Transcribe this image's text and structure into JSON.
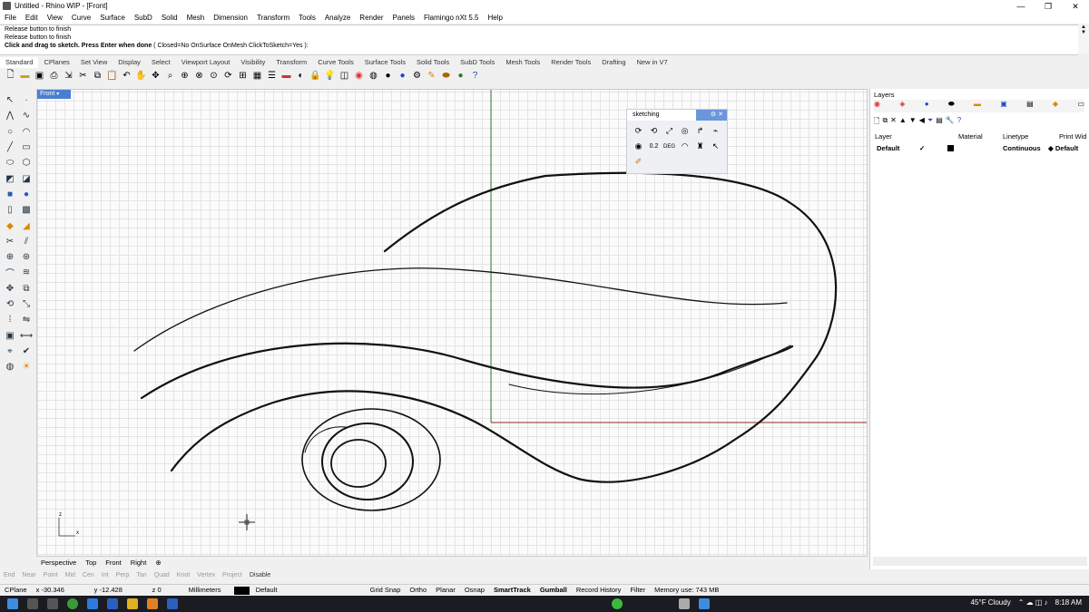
{
  "window": {
    "title": "Untitled - Rhino WIP - [Front]",
    "minimize": "—",
    "restore": "❐",
    "close": "✕"
  },
  "menu": [
    "File",
    "Edit",
    "View",
    "Curve",
    "Surface",
    "SubD",
    "Solid",
    "Mesh",
    "Dimension",
    "Transform",
    "Tools",
    "Analyze",
    "Render",
    "Panels",
    "Flamingo nXt 5.5",
    "Help"
  ],
  "command": {
    "history": [
      "Release button to finish",
      "Release button to finish"
    ],
    "prompt": "Click and drag to sketch. Press Enter when done",
    "options": "( Closed=No OnSurface OnMesh ClickToSketch=Yes ):"
  },
  "tabs": [
    "Standard",
    "CPlanes",
    "Set View",
    "Display",
    "Select",
    "Viewport Layout",
    "Visibility",
    "Transform",
    "Curve Tools",
    "Surface Tools",
    "Solid Tools",
    "SubD Tools",
    "Mesh Tools",
    "Render Tools",
    "Drafting",
    "New in V7"
  ],
  "toolbar_icons": [
    "new-icon",
    "open-icon",
    "save-icon",
    "print-icon",
    "import-icon",
    "cut-icon",
    "copy-icon",
    "paste-icon",
    "undo-icon",
    "pan-icon",
    "move-icon",
    "zoom-icon",
    "zoom-window-icon",
    "zoom-extents-icon",
    "zoom-selected-icon",
    "rotate-view-icon",
    "viewport-4-icon",
    "grid-icon",
    "properties-icon",
    "car-icon",
    "hide-icon",
    "lock-icon",
    "light-icon",
    "layer-icon",
    "color-icon",
    "material-icon",
    "render-icon",
    "render-preview-icon",
    "settings-icon",
    "pencil-icon",
    "car2-icon",
    "render-sphere-icon",
    "help-icon"
  ],
  "viewport": {
    "label": "Front",
    "x_label": "x",
    "z_label": "z"
  },
  "sketching_panel": {
    "title": "sketching",
    "gear": "⚙",
    "close": "✕",
    "value_label": "0.2",
    "deg_label": "DEG"
  },
  "viewport_tabs": [
    "Perspective",
    "Top",
    "Front",
    "Right",
    "⊕"
  ],
  "osnap": [
    "End",
    "Near",
    "Point",
    "Mid",
    "Cen",
    "Int",
    "Perp",
    "Tan",
    "Quad",
    "Knot",
    "Vertex",
    "Project",
    "Disable"
  ],
  "status": {
    "cplane": "CPlane",
    "x": "x -30.346",
    "y": "y -12.428",
    "z": "z 0",
    "units": "Millimeters",
    "layer": "Default",
    "grid_snap": "Grid Snap",
    "ortho": "Ortho",
    "planar": "Planar",
    "osnap": "Osnap",
    "smarttrack": "SmartTrack",
    "gumball": "Gumball",
    "record": "Record History",
    "filter": "Filter",
    "memory": "Memory use: 743 MB"
  },
  "layers": {
    "title": "Layers",
    "headers": [
      "Layer",
      "Material",
      "Linetype",
      "Print Wid"
    ],
    "row": {
      "name": "Default",
      "check": "✓",
      "linetype": "Continuous",
      "print": "◆ Default"
    }
  },
  "taskbar": {
    "weather": "45°F  Cloudy",
    "time": "8:18 AM"
  },
  "colors": {
    "viewport_bg": "#fbfbfb",
    "grid": "#e4e4e4",
    "x_axis": "#8b2a1f",
    "y_axis": "#3a7a3a",
    "accent": "#4a7fd0"
  }
}
